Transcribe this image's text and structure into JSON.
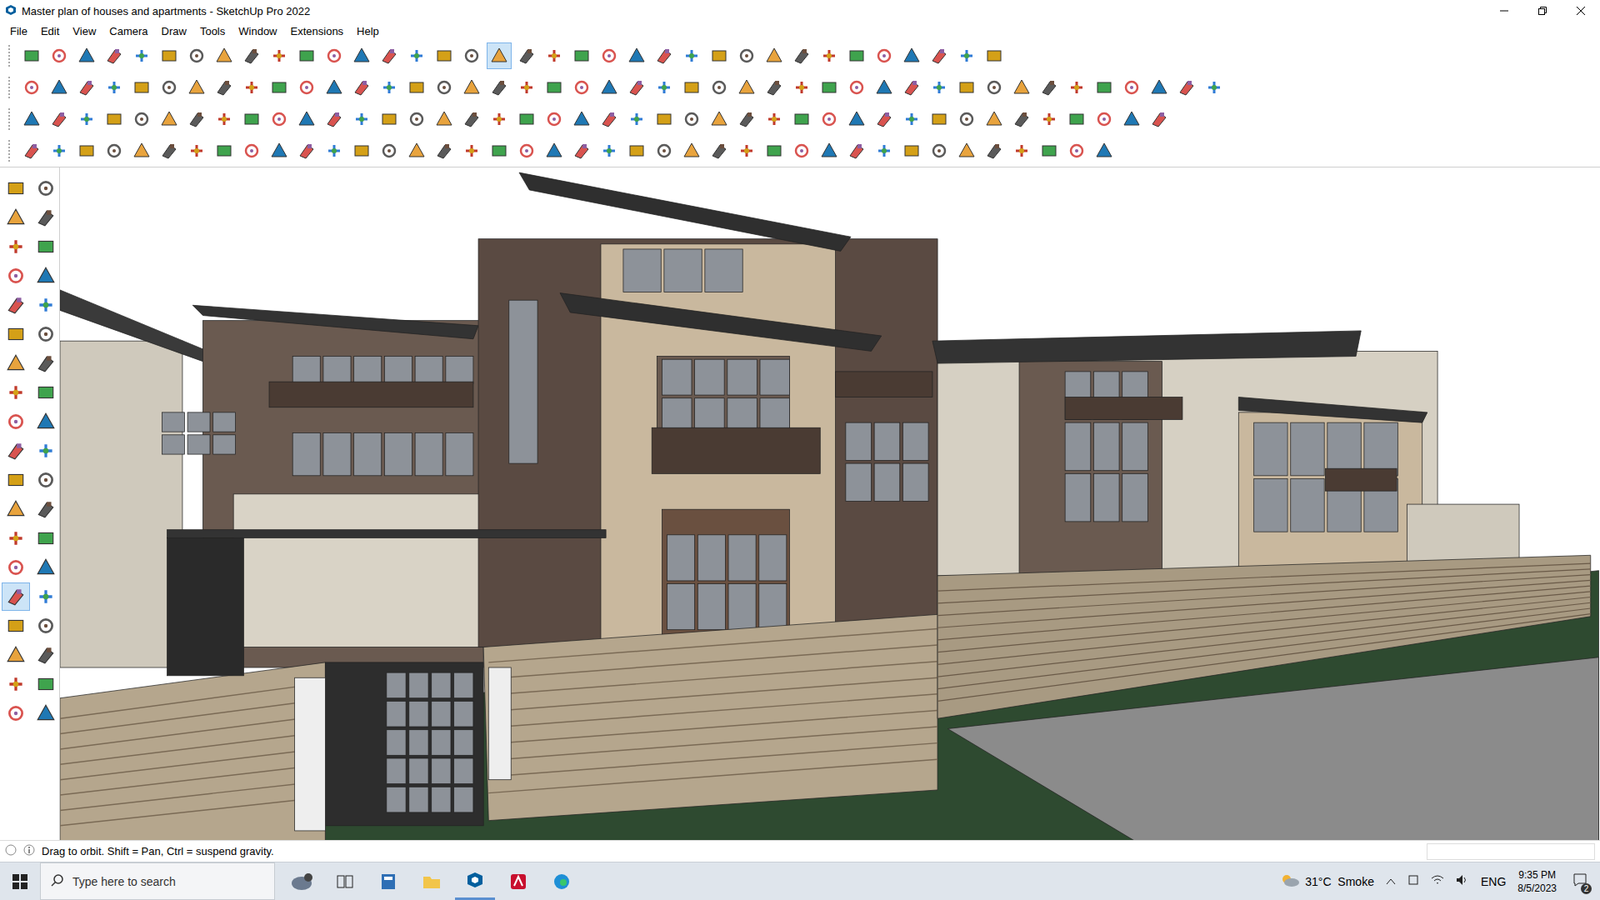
{
  "window": {
    "title": "Master plan of houses and apartments - SketchUp Pro 2022"
  },
  "menu": [
    "File",
    "Edit",
    "View",
    "Camera",
    "Draw",
    "Tools",
    "Window",
    "Extensions",
    "Help"
  ],
  "main_toolbar": [
    {
      "selected": false
    },
    {
      "selected": false
    },
    {
      "selected": false
    },
    {
      "selected": false
    },
    {
      "selected": false
    },
    {
      "selected": false
    },
    {
      "selected": false
    },
    {
      "selected": false
    },
    {
      "selected": false
    },
    {
      "selected": false
    },
    {
      "selected": false
    },
    {
      "selected": false
    },
    {
      "selected": false
    },
    {
      "selected": false
    },
    {
      "selected": false
    },
    {
      "selected": false
    },
    {
      "selected": false
    },
    {
      "selected": true
    },
    {
      "selected": false
    },
    {
      "selected": false
    },
    {
      "selected": false
    },
    {
      "selected": false
    },
    {
      "selected": false
    },
    {
      "selected": false
    },
    {
      "selected": false
    },
    {
      "selected": false
    },
    {
      "selected": false
    },
    {
      "selected": false
    },
    {
      "selected": false
    },
    {
      "selected": false
    },
    {
      "selected": false
    },
    {
      "selected": false
    },
    {
      "selected": false
    },
    {
      "selected": false
    },
    {
      "selected": false
    },
    {
      "selected": false
    }
  ],
  "tool_palette": [
    {
      "selected": false
    },
    {
      "selected": false
    },
    {
      "selected": false
    },
    {
      "selected": false
    },
    {
      "selected": false
    },
    {
      "selected": false
    },
    {
      "selected": false
    },
    {
      "selected": false
    },
    {
      "selected": false
    },
    {
      "selected": false
    },
    {
      "selected": false
    },
    {
      "selected": false
    },
    {
      "selected": false
    },
    {
      "selected": false
    },
    {
      "selected": false
    },
    {
      "selected": false
    },
    {
      "selected": false
    },
    {
      "selected": false
    },
    {
      "selected": false
    },
    {
      "selected": false
    },
    {
      "selected": false
    },
    {
      "selected": false
    },
    {
      "selected": false
    },
    {
      "selected": false
    },
    {
      "selected": false
    },
    {
      "selected": false
    },
    {
      "selected": false
    },
    {
      "selected": false
    },
    {
      "selected": true
    },
    {
      "selected": false
    },
    {
      "selected": false
    },
    {
      "selected": false
    },
    {
      "selected": false
    },
    {
      "selected": false
    },
    {
      "selected": false
    },
    {
      "selected": false
    },
    {
      "selected": false
    },
    {
      "selected": false
    }
  ],
  "status_bar": {
    "text": "Drag to orbit. Shift = Pan, Ctrl = suspend gravity."
  },
  "taskbar": {
    "search_placeholder": "Type here to search",
    "weather": "31°C  Smoke",
    "language": "ENG",
    "time": "9:35 PM",
    "date": "8/5/2023",
    "notifications": "2"
  }
}
